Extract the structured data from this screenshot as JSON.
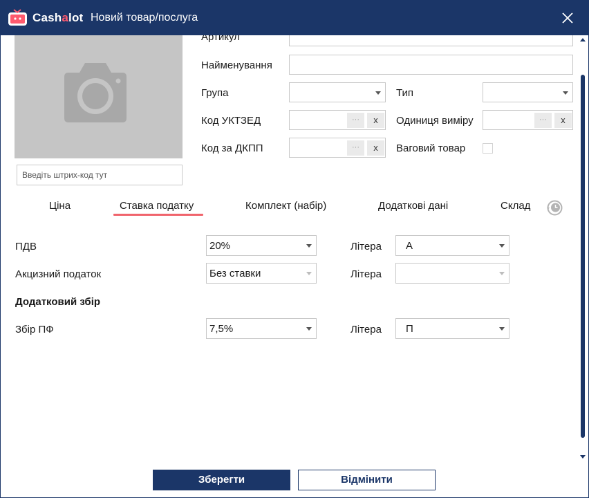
{
  "window": {
    "brand_prefix": "Cash",
    "brand_accent": "a",
    "brand_suffix": "lot",
    "title": "Новий товар/послуга",
    "close_icon": "close-icon"
  },
  "colors": {
    "titlebar": "#1b3668",
    "accent": "#f0646c",
    "photo_placeholder": "#c5c5c5"
  },
  "photo": {
    "icon": "camera-icon"
  },
  "barcode": {
    "placeholder": "Введіть штрих-код тут",
    "value": ""
  },
  "form": {
    "article_label": "Артикул",
    "name_label": "Найменування",
    "group_label": "Група",
    "group_value": "",
    "type_label": "Тип",
    "type_value": "",
    "uktzed_label": "Код УКТЗЕД",
    "unit_label": "Одиниця виміру",
    "dkpp_label": "Код за ДКПП",
    "weight_label": "Ваговий товар",
    "weight_checked": false,
    "browse_btn": "···",
    "clear_btn": "x"
  },
  "tabs": [
    {
      "label": "Ціна"
    },
    {
      "label": "Ставка податку",
      "active": true
    },
    {
      "label": "Комплект (набір)"
    },
    {
      "label": "Додаткові дані"
    },
    {
      "label": "Склад"
    }
  ],
  "history_icon": "history-clock-icon",
  "tax": {
    "vat_label": "ПДВ",
    "vat_value": "20%",
    "letter_label": "Літера",
    "vat_letter": "А",
    "excise_label": "Акцизний податок",
    "excise_value": "Без ставки",
    "excise_letter": "",
    "extra_header": "Додатковий збір",
    "pf_label": "Збір ПФ",
    "pf_value": "7,5%",
    "pf_letter": "П"
  },
  "buttons": {
    "save": "Зберегти",
    "cancel": "Відмінити"
  }
}
